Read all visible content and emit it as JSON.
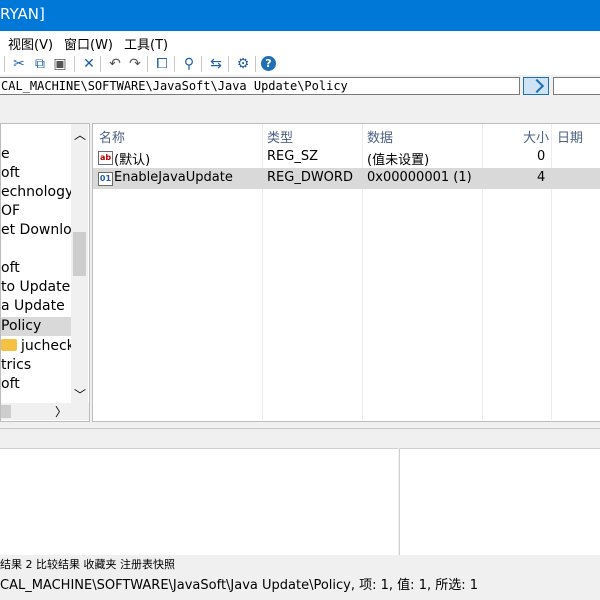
{
  "window": {
    "title_fragment": "RYAN]"
  },
  "menu": [
    "视图(V)",
    "窗口(W)",
    "工具(T)"
  ],
  "toolbar_icons": [
    "cut-icon",
    "copy-icon",
    "paste-icon",
    "delete-icon",
    "undo-icon",
    "redo-icon",
    "copy-path-icon",
    "find-icon",
    "jump-icon",
    "settings-icon",
    "help-icon"
  ],
  "address": {
    "path": "CAL_MACHINE\\SOFTWARE\\JavaSoft\\Java Update\\Policy"
  },
  "tree": {
    "items": [
      {
        "label": "e"
      },
      {
        "label": "oft"
      },
      {
        "label": "echnology"
      },
      {
        "label": "OF"
      },
      {
        "label": "et Downloa"
      },
      {
        "label": ""
      },
      {
        "label": "oft"
      },
      {
        "label": "to Update"
      },
      {
        "label": "a Update"
      },
      {
        "label": "Policy"
      },
      {
        "label": "jucheck"
      },
      {
        "label": "trics"
      },
      {
        "label": "oft"
      }
    ]
  },
  "list": {
    "headers": {
      "name": "名称",
      "type": "类型",
      "data": "数据",
      "size": "大小",
      "date": "日期"
    },
    "rows": [
      {
        "icon": "ab",
        "name": "(默认)",
        "type": "REG_SZ",
        "data": "(值未设置)",
        "size": "0"
      },
      {
        "icon": "binary",
        "name": "EnableJavaUpdate",
        "type": "REG_DWORD",
        "data": "0x00000001 (1)",
        "size": "4"
      }
    ]
  },
  "bottom_tabs": "结果 2  比较结果  收藏夹  注册表快照",
  "status": "CAL_MACHINE\\SOFTWARE\\JavaSoft\\Java Update\\Policy, 项: 1, 值: 1, 所选: 1",
  "colors": {
    "titlebar": "#0078d7",
    "selection": "#d9d9d9"
  }
}
